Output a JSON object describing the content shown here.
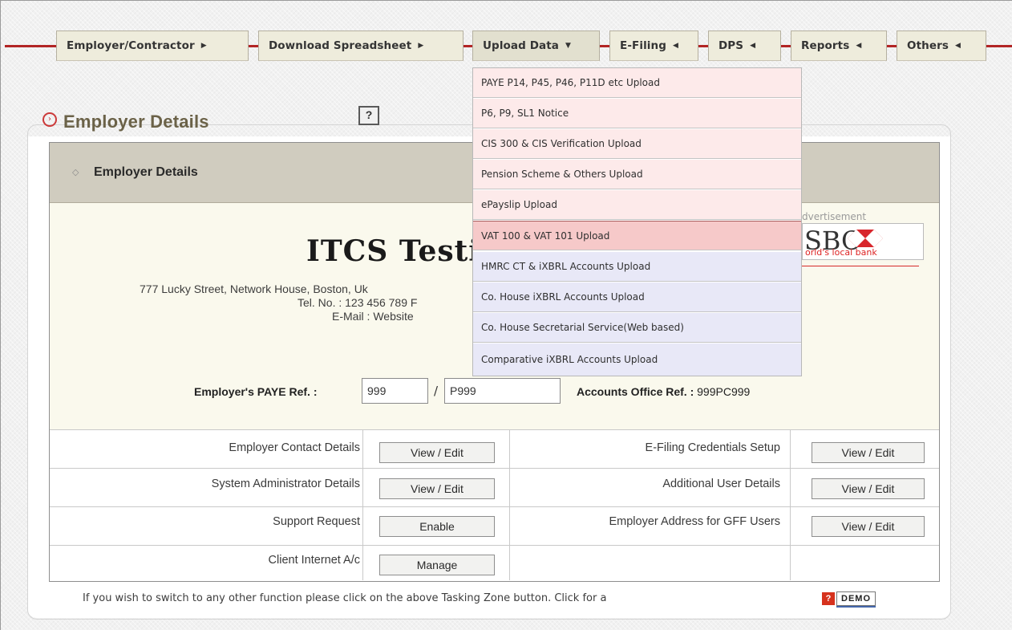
{
  "menu": [
    {
      "label": "Employer/Contractor",
      "arrow": "▶"
    },
    {
      "label": "Download Spreadsheet",
      "arrow": "▶"
    },
    {
      "label": "Upload Data",
      "arrow": "▼"
    },
    {
      "label": "E-Filing",
      "arrow": "◀"
    },
    {
      "label": "DPS",
      "arrow": "◀"
    },
    {
      "label": "Reports",
      "arrow": "◀"
    },
    {
      "label": "Others",
      "arrow": "◀"
    }
  ],
  "dropdown": {
    "items": [
      "PAYE P14, P45, P46, P11D etc Upload",
      "P6, P9, SL1 Notice",
      "CIS 300 & CIS Verification Upload",
      "Pension Scheme & Others Upload",
      "ePayslip Upload",
      "VAT 100 & VAT 101 Upload",
      "HMRC CT & iXBRL Accounts Upload",
      "Co. House iXBRL Accounts Upload",
      "Co. House Secretarial Service(Web based)",
      "Comparative iXBRL Accounts Upload"
    ],
    "highlighted": "VAT 100 & VAT 101 Upload",
    "colors": {
      "pink": "#fdeaea",
      "highlight": "#f6c9c9",
      "blue": "#e8e8f7"
    }
  },
  "panel": {
    "title": "Employer Details",
    "help_label": "?",
    "section_title": "Employer Details",
    "company_name": "ITCS Testing",
    "address_line": "777 Lucky Street, Network House, Boston, Uk",
    "tel_line": "Tel. No. : 123 456 789   F",
    "email_line": "E-Mail :   Website",
    "paye_label": "Employer's PAYE Ref. :",
    "paye_ref_1": "999",
    "paye_ref_2": "P999",
    "paye_slash": "/",
    "accounts_office_label": "Accounts Office Ref. :",
    "accounts_office_value": "999PC999",
    "ad_label": "dvertisement",
    "ad_brand": "SBC",
    "ad_tagline": "orld's local bank"
  },
  "rows": [
    {
      "left_label": "Employer Contact Details",
      "left_button": "View / Edit",
      "right_label": "E-Filing Credentials Setup",
      "right_button": "View / Edit"
    },
    {
      "left_label": "System Administrator Details",
      "left_button": "View / Edit",
      "right_label": "Additional User Details",
      "right_button": "View / Edit"
    },
    {
      "left_label": "Support Request",
      "left_button": "Enable",
      "right_label": "Employer Address for GFF Users",
      "right_button": "View / Edit"
    },
    {
      "left_label": "Client Internet A/c",
      "left_button": "Manage",
      "right_label": "",
      "right_button": ""
    }
  ],
  "footer": {
    "text": "If you wish to switch to any other function please click on the above Tasking Zone button. Click for a",
    "demo_label": "DEMO",
    "demo_icon": "?"
  },
  "colors": {
    "accent_red": "#b22525",
    "title_brown": "#6b6248",
    "header_bar": "#d0ccbf"
  }
}
